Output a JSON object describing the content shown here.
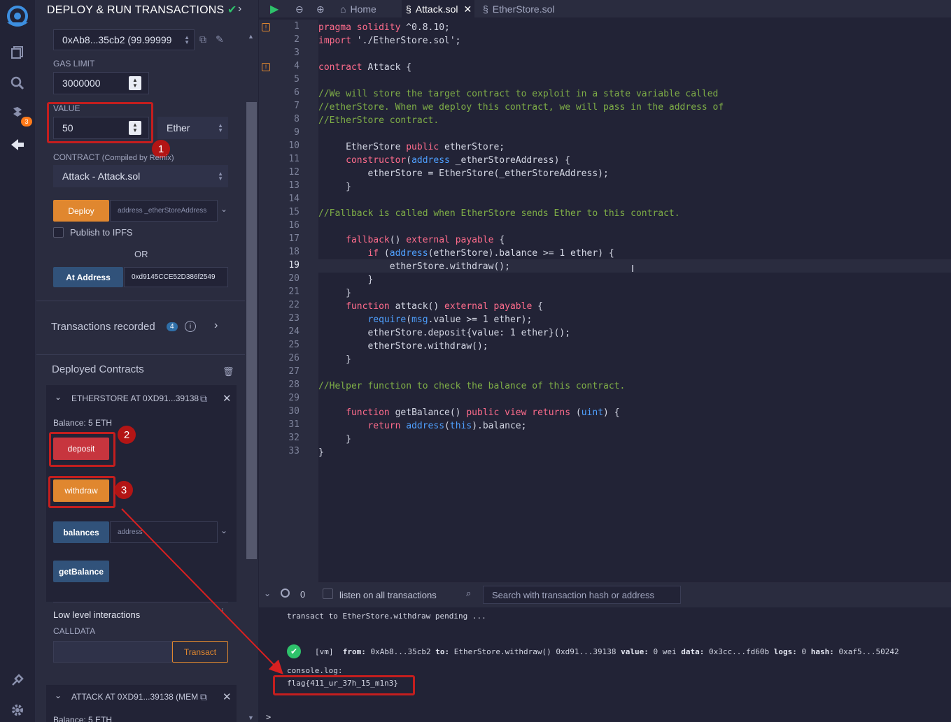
{
  "panel": {
    "title": "DEPLOY & RUN TRANSACTIONS",
    "account_value": "0xAb8...35cb2 (99.99999",
    "gas_limit_label": "GAS LIMIT",
    "gas_limit_value": "3000000",
    "value_label": "VALUE",
    "value_amount": "50",
    "value_unit": "Ether",
    "contract_label": "CONTRACT",
    "contract_note": "(Compiled by Remix)",
    "contract_selected": "Attack - Attack.sol",
    "deploy_label": "Deploy",
    "deploy_placeholder": "address _etherStoreAddress",
    "publish_label": "Publish to IPFS",
    "or_label": "OR",
    "at_address_label": "At Address",
    "at_address_value": "0xd9145CCE52D386f2549",
    "transactions_label": "Transactions recorded",
    "transactions_count": "4",
    "deployed_label": "Deployed Contracts",
    "etherstore_title": "ETHERSTORE AT 0XD91...39138",
    "etherstore_balance": "Balance: 5 ETH",
    "deposit_label": "deposit",
    "withdraw_label": "withdraw",
    "balances_label": "balances",
    "balances_placeholder": "address",
    "getbalance_label": "getBalance",
    "low_level_label": "Low level interactions",
    "calldata_label": "CALLDATA",
    "transact_label": "Transact",
    "attack_title": "ATTACK AT 0XD91...39138 (MEM",
    "attack_balance": "Balance: 5 ETH"
  },
  "annotations": [
    "1",
    "2",
    "3"
  ],
  "tabs": {
    "home": "Home",
    "attack": "Attack.sol",
    "etherstore": "EtherStore.sol"
  },
  "editor": {
    "line_numbers": [
      "1",
      "2",
      "3",
      "4",
      "5",
      "6",
      "7",
      "8",
      "9",
      "10",
      "11",
      "12",
      "13",
      "14",
      "15",
      "16",
      "17",
      "18",
      "19",
      "20",
      "21",
      "22",
      "23",
      "24",
      "25",
      "26",
      "27",
      "28",
      "29",
      "30",
      "31",
      "32",
      "33"
    ]
  },
  "terminal": {
    "count": "0",
    "listen_label": "listen on all transactions",
    "search_placeholder": "Search with transaction hash or address",
    "pending": "transact to EtherStore.withdraw pending ...",
    "vm": "[vm]",
    "from_label": "from:",
    "from": "0xAb8...35cb2",
    "to_label": "to:",
    "to": "EtherStore.withdraw() 0xd91...39138",
    "value_label": "value:",
    "value": "0 wei",
    "data_label": "data:",
    "data": "0x3cc...fd60b",
    "logs_label": "logs:",
    "logs": "0",
    "hash_label": "hash:",
    "hash": "0xaf5...50242",
    "console": "console.log:",
    "flag": "flag{411_ur_37h_15_m1n3}",
    "prompt": ">"
  },
  "colors": {
    "accent_orange": "#e0872f",
    "accent_blue": "#31527a",
    "accent_red": "#c7353e",
    "highlight": "#c41e1e"
  }
}
